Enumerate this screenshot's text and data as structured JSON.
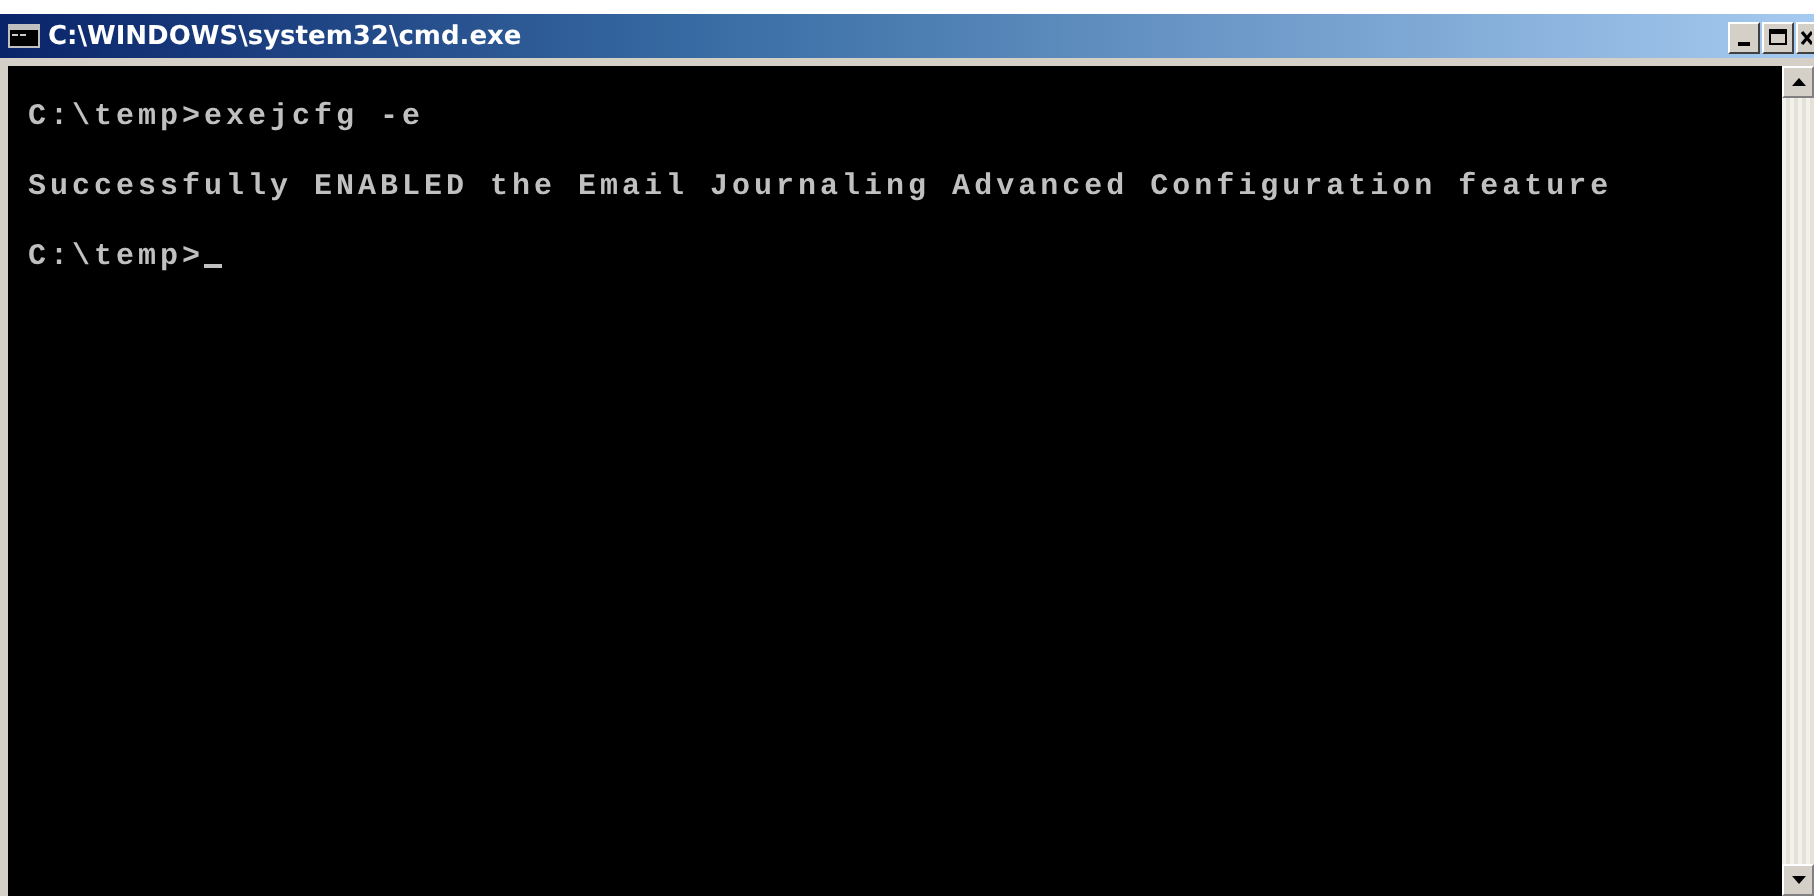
{
  "window": {
    "title": "C:\\WINDOWS\\system32\\cmd.exe"
  },
  "console": {
    "lines": [
      {
        "kind": "text",
        "text": "C:\\temp>exejcfg -e",
        "cursor": false
      },
      {
        "kind": "blank"
      },
      {
        "kind": "text",
        "text": "Successfully ENABLED the Email Journaling Advanced Configuration feature",
        "cursor": false
      },
      {
        "kind": "blank"
      },
      {
        "kind": "text",
        "text": "C:\\temp>",
        "cursor": true
      }
    ]
  }
}
